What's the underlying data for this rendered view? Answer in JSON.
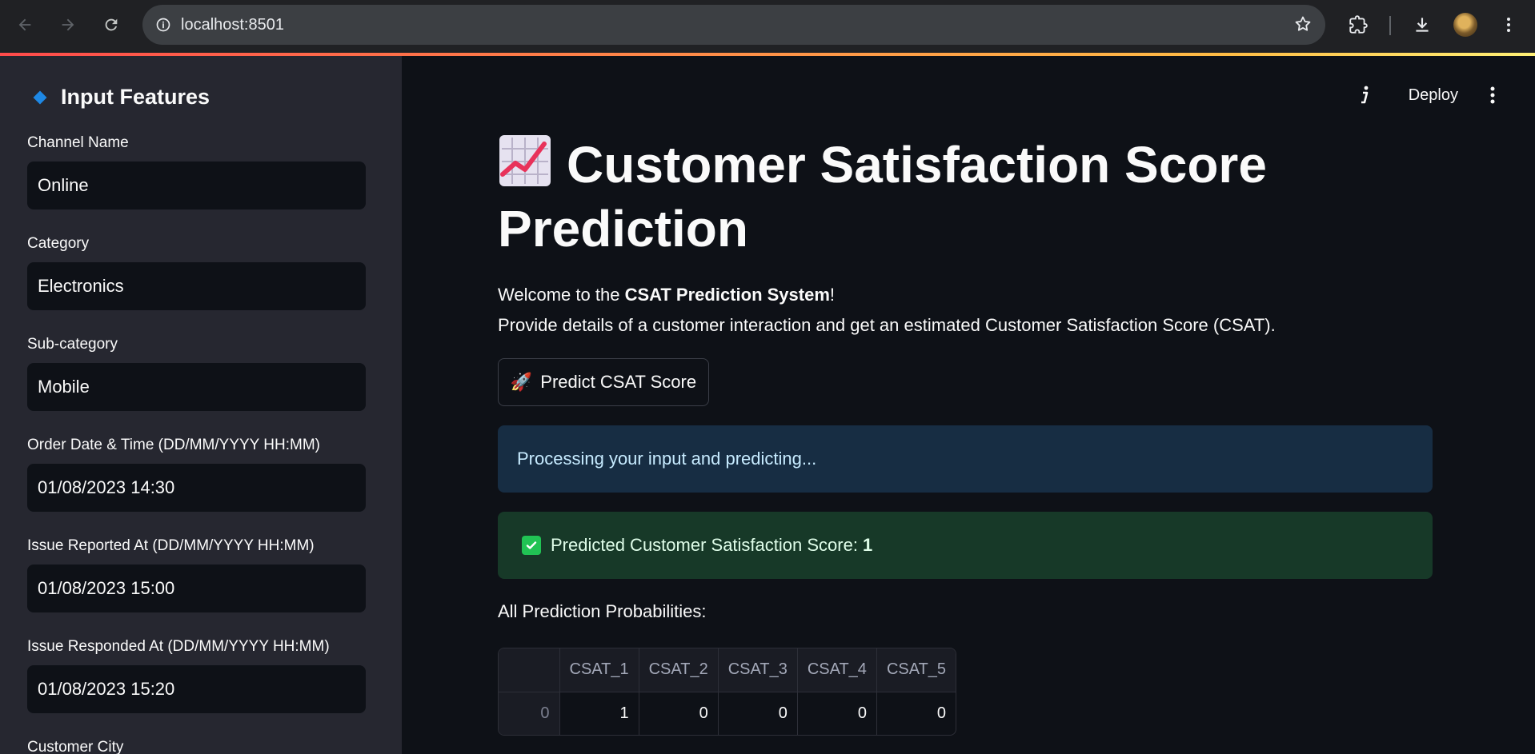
{
  "browser": {
    "url": "localhost:8501"
  },
  "sidebar": {
    "title": "Input Features",
    "fields": [
      {
        "label": "Channel Name",
        "value": "Online"
      },
      {
        "label": "Category",
        "value": "Electronics"
      },
      {
        "label": "Sub-category",
        "value": "Mobile"
      },
      {
        "label": "Order Date & Time (DD/MM/YYYY HH:MM)",
        "value": "01/08/2023 14:30"
      },
      {
        "label": "Issue Reported At (DD/MM/YYYY HH:MM)",
        "value": "01/08/2023 15:00"
      },
      {
        "label": "Issue Responded At (DD/MM/YYYY HH:MM)",
        "value": "01/08/2023 15:20"
      },
      {
        "label": "Customer City",
        "value": ""
      }
    ]
  },
  "toolbar": {
    "deploy_label": "Deploy"
  },
  "main": {
    "title": "Customer Satisfaction Score Prediction",
    "welcome_prefix": "Welcome to the ",
    "welcome_bold": "CSAT Prediction System",
    "welcome_suffix": "!",
    "description": "Provide details of a customer interaction and get an estimated Customer Satisfaction Score (CSAT).",
    "predict_button": "Predict CSAT Score",
    "info_message": "Processing your input and predicting...",
    "success_prefix": "Predicted Customer Satisfaction Score: ",
    "success_score": "1",
    "probs_label": "All Prediction Probabilities:",
    "table": {
      "columns": [
        "",
        "CSAT_1",
        "CSAT_2",
        "CSAT_3",
        "CSAT_4",
        "CSAT_5"
      ],
      "rows": [
        [
          "0",
          "1",
          "0",
          "0",
          "0",
          "0"
        ]
      ]
    }
  },
  "colors": {
    "accent_red": "#ff4b4b",
    "info_bg": "#172d43",
    "success_bg": "#173928",
    "sidebar_bg": "#262730",
    "main_bg": "#0e1117"
  }
}
